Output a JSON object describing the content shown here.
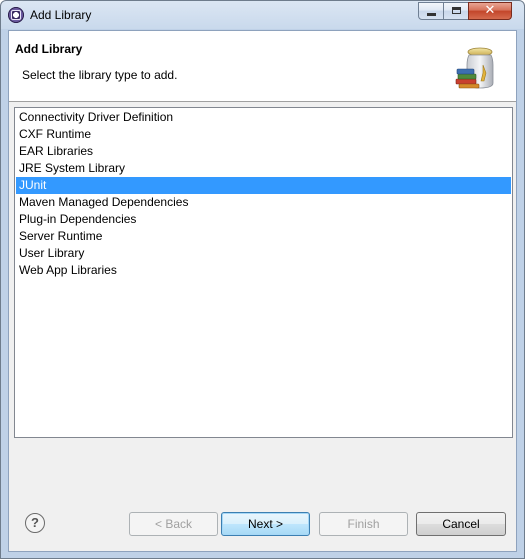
{
  "window": {
    "title": "Add Library"
  },
  "header": {
    "title": "Add Library",
    "description": "Select the library type to add.",
    "icon": "library-jar-books-icon"
  },
  "library_types": {
    "items": [
      {
        "label": "Connectivity Driver Definition",
        "selected": false
      },
      {
        "label": "CXF Runtime",
        "selected": false
      },
      {
        "label": "EAR Libraries",
        "selected": false
      },
      {
        "label": "JRE System Library",
        "selected": false
      },
      {
        "label": "JUnit",
        "selected": true
      },
      {
        "label": "Maven Managed Dependencies",
        "selected": false
      },
      {
        "label": "Plug-in Dependencies",
        "selected": false
      },
      {
        "label": "Server Runtime",
        "selected": false
      },
      {
        "label": "User Library",
        "selected": false
      },
      {
        "label": "Web App Libraries",
        "selected": false
      }
    ],
    "selection_color": "#3399ff"
  },
  "footer": {
    "help_label": "?",
    "back_label": "< Back",
    "next_label": "Next >",
    "finish_label": "Finish",
    "cancel_label": "Cancel"
  }
}
